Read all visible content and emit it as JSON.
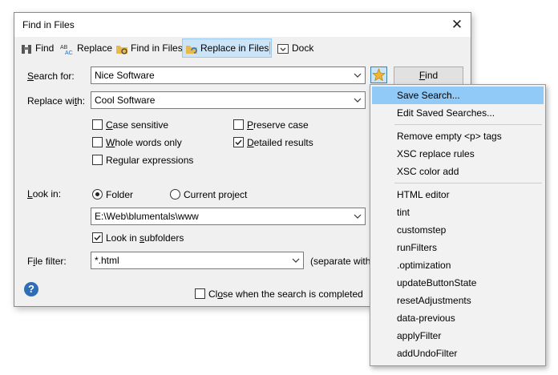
{
  "window": {
    "title": "Find in Files",
    "close_glyph": "✕"
  },
  "toolbar": {
    "items": [
      {
        "label": "Find",
        "icon": "binoculars-icon"
      },
      {
        "label": "Replace",
        "icon": "replace-icon"
      },
      {
        "label": "Find in Files",
        "icon": "folder-search-icon"
      },
      {
        "label": "Replace in Files",
        "icon": "folder-replace-icon",
        "active": true
      },
      {
        "label": "Dock",
        "icon": "dock-icon"
      }
    ]
  },
  "form": {
    "search_label_key": "S",
    "search_label_rest": "earch for:",
    "search_value": "Nice Software",
    "replace_label_pre": "Replace wi",
    "replace_label_key": "t",
    "replace_label_post": "h:",
    "replace_value": "Cool Software",
    "find_button_key": "F",
    "find_button_rest": "ind",
    "options": {
      "case_sensitive": {
        "key": "C",
        "rest": "ase sensitive",
        "checked": false
      },
      "whole_words": {
        "key": "W",
        "rest": "hole words only",
        "checked": false
      },
      "regex": {
        "pre": "Re",
        "key": "g",
        "rest": "ular expressions",
        "checked": false
      },
      "preserve_case": {
        "key": "P",
        "rest": "reserve case",
        "checked": false
      },
      "detailed_results": {
        "key": "D",
        "rest": "etailed results",
        "checked": true
      }
    },
    "look_in_key": "L",
    "look_in_rest": "ook in:",
    "look_in_folder": "Folder",
    "look_in_project": "Current project",
    "look_in_selected": "Folder",
    "path_value": "E:\\Web\\blumentals\\www",
    "subfolders_pre": "Look in ",
    "subfolders_key": "s",
    "subfolders_post": "ubfolders",
    "subfolders_checked": true,
    "file_filter_pre": "F",
    "file_filter_key": "i",
    "file_filter_post": "le filter:",
    "file_filter_value": "*.html",
    "file_filter_hint": "(separate with",
    "close_when_pre": "Cl",
    "close_when_key": "o",
    "close_when_post": "se when the search is completed",
    "close_when_checked": false,
    "help_glyph": "?"
  },
  "menu": {
    "items": [
      "Save Search...",
      "Edit Saved Searches...",
      "Remove empty <p> tags",
      "XSC replace rules",
      "XSC color add",
      "HTML editor",
      "tint",
      "customstep",
      "runFilters",
      ".optimization",
      "updateButtonState",
      "resetAdjustments",
      "data-previous",
      "applyFilter",
      "addUndoFilter"
    ],
    "highlighted": "Save Search..."
  },
  "colors": {
    "accent": "#cce4f7",
    "menu_highlight": "#91c9f7",
    "help": "#2f6db5"
  }
}
